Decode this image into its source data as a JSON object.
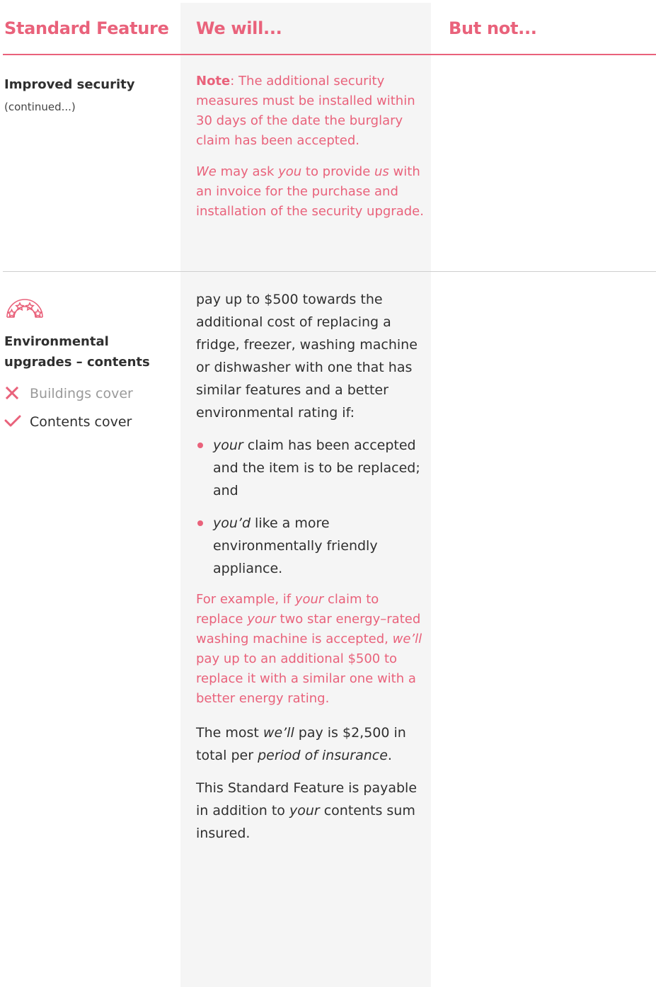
{
  "header": {
    "col1": "Standard Feature",
    "col2": "We will...",
    "col3": "But not..."
  },
  "row1": {
    "title": "Improved security",
    "subtitle": "(continued...)",
    "note_label": "Note",
    "note_text": ": The additional security measures must be installed within 30 days of the date the burglary claim has been accepted.",
    "invoice": {
      "we": "We",
      "t1": " may ask ",
      "you": "you",
      "t2": " to provide ",
      "us": "us",
      "t3": " with an invoice for the purchase and installation of the security upgrade."
    }
  },
  "row2": {
    "icon": "stars-rainbow-icon",
    "title": "Environmental upgrades – contents",
    "covers": [
      {
        "icon": "cross-icon",
        "label": "Buildings cover",
        "included": false
      },
      {
        "icon": "check-icon",
        "label": "Contents cover",
        "included": true
      }
    ],
    "intro": "pay up to $500 towards the additional cost of replacing a fridge, freezer, washing machine or dishwasher with one that has similar features and a better environmental rating if:",
    "bullets": [
      {
        "em": "your",
        "text": " claim has been accepted and the item is to be replaced; and"
      },
      {
        "em": "you’d",
        "text": " like a more environmentally friendly appliance."
      }
    ],
    "example": {
      "t1": "For example, if ",
      "your1": "your",
      "t2": " claim to replace ",
      "your2": "your",
      "t3": " two star energy–rated washing machine is accepted, ",
      "well": "we’ll",
      "t4": " pay up to an additional $500 to replace it with a similar one with a better energy rating."
    },
    "most": {
      "t1": "The most ",
      "well": "we’ll",
      "t2": " pay is $2,500 in total per ",
      "period": "period of insurance",
      "t3": "."
    },
    "payable": {
      "t1": "This Standard Feature is payable in addition to ",
      "your": "your",
      "t2": " contents sum insured."
    }
  },
  "colors": {
    "accent": "#e9627b",
    "shade": "#f5f5f5",
    "rule": "#cfcfcf",
    "muted": "#9a9a9a"
  }
}
